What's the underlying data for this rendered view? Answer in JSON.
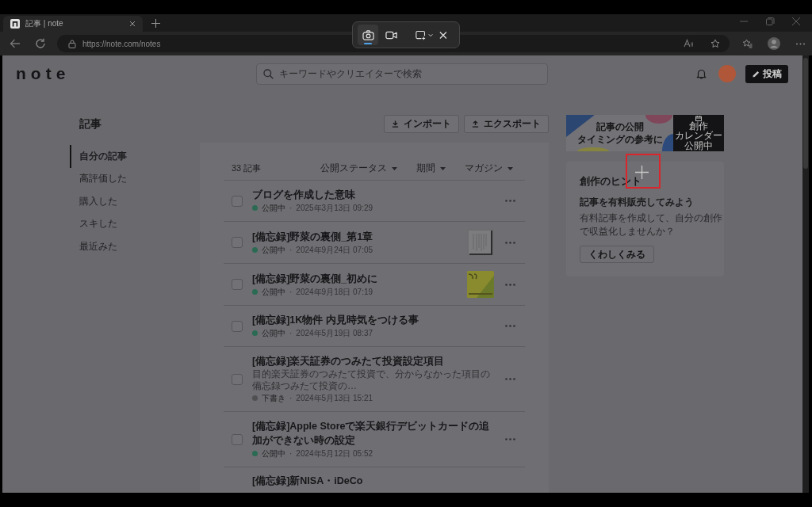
{
  "browser": {
    "tab_title": "記事 | note",
    "address": "https://note.com/notes"
  },
  "snip_toolbar": {
    "modes": [
      {
        "kind": "photo",
        "selected": true
      },
      {
        "kind": "video",
        "selected": false
      },
      {
        "kind": "region",
        "selected": false
      }
    ]
  },
  "header": {
    "logo": "note",
    "search": {
      "placeholder": "キーワードやクリエイターで検索"
    },
    "post_button": "投稿"
  },
  "page_title": "記事",
  "sidebar": {
    "items": [
      {
        "label": "自分の記事",
        "selected": true
      },
      {
        "label": "高評価した",
        "selected": false
      },
      {
        "label": "購入した",
        "selected": false
      },
      {
        "label": "スキした",
        "selected": false
      },
      {
        "label": "最近みた",
        "selected": false
      }
    ]
  },
  "actions": [
    {
      "kind": "import",
      "label": "インポート"
    },
    {
      "kind": "export",
      "label": "エクスポート"
    }
  ],
  "article_list": {
    "count": "33 記事",
    "filters": [
      "公開ステータス",
      "期間",
      "マガジン"
    ],
    "articles": [
      {
        "title": "ブログを作成した意味",
        "status": "公開中",
        "color": "#2b6a53",
        "separator": "·",
        "date": "2025年3月13日 09:29",
        "checked": false
      },
      {
        "title": "[備忘録]野菜の裏側_第1章",
        "status": "公開中",
        "color": "#2b6a53",
        "separator": "·",
        "date": "2024年9月24日 07:05",
        "thumbnail": {
          "kind": "page"
        },
        "checked": false
      },
      {
        "title": "[備忘録]野菜の裏側_初めに",
        "status": "公開中",
        "color": "#2b6a53",
        "separator": "·",
        "date": "2024年9月18日 07:19",
        "thumbnail": {
          "kind": "cover"
        },
        "checked": false
      },
      {
        "title": "[備忘録]1K物件 内見時気をつける事",
        "status": "公開中",
        "color": "#2b6a53",
        "separator": "·",
        "date": "2024年5月19日 08:37",
        "checked": false
      },
      {
        "title": "[備忘録]楽天証券のつみたて投資設定項目",
        "excerpt": "目的楽天証券のつみたて投資で、分からなかった項目の備忘録つみたて投資の…",
        "status": "下書き",
        "color": "#505053",
        "separator": "·",
        "date": "2024年5月13日 15:21",
        "checked": false
      },
      {
        "title": "[備忘録]Apple Storeで楽天銀行デビットカードの追加ができない時の設定",
        "status": "公開中",
        "color": "#2b6a53",
        "separator": "·",
        "date": "2024年5月12日 05:52",
        "checked": false
      }
    ],
    "partial_row": {
      "title": "[備忘録]新NISA・iDeCo"
    }
  },
  "banner": {
    "lines": [
      "記事の公開",
      "タイミングの参考に"
    ],
    "badge_lines": [
      "創作",
      "カレンダー",
      "公開中"
    ]
  },
  "hint_card": {
    "title": "創作のヒント",
    "heading": "記事を有料販売してみよう",
    "body": "有料記事を作成して、自分の創作で収益化しませんか？",
    "button": "くわしくみる"
  },
  "annotation": {
    "kind": "box",
    "cursor": true
  }
}
